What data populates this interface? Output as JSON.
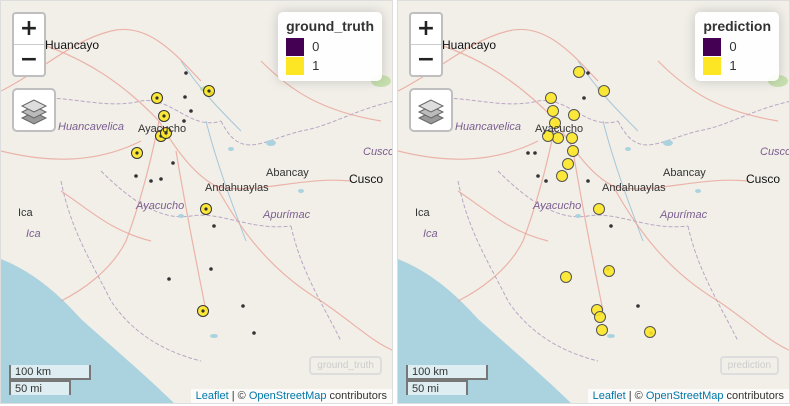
{
  "panels": [
    {
      "id": "left",
      "legend_title": "ground_truth",
      "watermark": "ground_truth",
      "point_style": "gt"
    },
    {
      "id": "right",
      "legend_title": "prediction",
      "watermark": "prediction",
      "point_style": "pred"
    }
  ],
  "legend": {
    "items": [
      {
        "label": "0",
        "color": "#440154"
      },
      {
        "label": "1",
        "color": "#fde725"
      }
    ]
  },
  "zoom": {
    "in": "+",
    "out": "−"
  },
  "scale": {
    "km": "100 km",
    "mi": "50 mi"
  },
  "attribution": {
    "leaflet": "Leaflet",
    "sep": " | © ",
    "osm": "OpenStreetMap",
    "suffix": " contributors"
  },
  "places": {
    "huancayo": "Huancayo",
    "ayacucho_city": "Ayacucho",
    "huancavelica": "Huancavelica",
    "abancay": "Abancay",
    "cusco_city": "Cusco",
    "cusco_region": "Cusco",
    "andahuaylas": "Andahuaylas",
    "ica_city": "Ica",
    "ica_region": "Ica",
    "ayacucho_region": "Ayacucho",
    "apurimac": "Apurímac"
  },
  "colors": {
    "class0": "#440154",
    "class1": "#fde725",
    "land": "#f2efe9",
    "sea": "#aad3df",
    "road": "#e8a497",
    "boundary": "#b9a7c4"
  }
}
